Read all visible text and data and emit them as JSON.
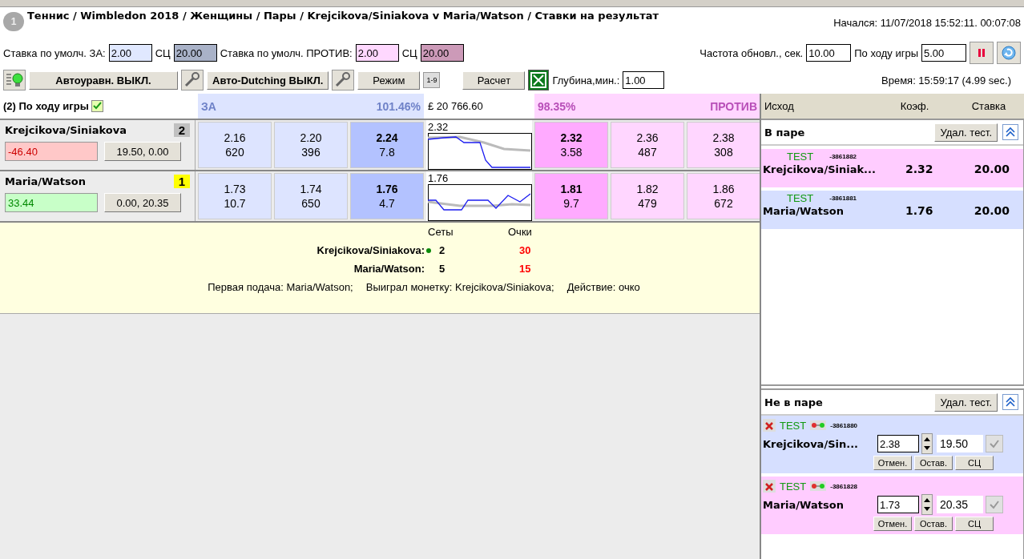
{
  "header": {
    "icon_label": "1",
    "title": "Теннис / Wimbledon 2018 / Женщины / Пары / Krejcikova/Siniakova v Maria/Watson / Ставки на результат",
    "started": "Начался: 11/07/2018 15:52:11. 00:07:08"
  },
  "stakes": {
    "back_label": "Ставка по умолч. ЗА:",
    "back_value": "2.00",
    "back_sc_label": "СЦ",
    "back_sc_value": "20.00",
    "lay_label": "Ставка по умолч. ПРОТИВ:",
    "lay_value": "2.00",
    "lay_sc_label": "СЦ",
    "lay_sc_value": "20.00",
    "refresh_label": "Частота обновл., сек.",
    "refresh_value": "10.00",
    "inplay_label": "По ходу игры",
    "inplay_value": "5.00"
  },
  "toolbar": {
    "autobalance": "Автоуравн. ВЫКЛ.",
    "dutching": "Авто-Dutching ВЫКЛ.",
    "mode": "Режим",
    "ladder_icon_label": "1-9",
    "calc": "Расчет",
    "depth_label": "Глубина,мин.:",
    "depth_value": "1.00",
    "time": "Время: 15:59:17 (4.99 sec.)"
  },
  "market": {
    "title": "(2) По ходу игры",
    "checked": true,
    "back_header": "ЗА",
    "back_percent": "101.46%",
    "matched": "£ 20 766.60",
    "lay_percent": "98.35%",
    "lay_header": "ПРОТИВ"
  },
  "runners": [
    {
      "name": "Krejcikova/Siniakova",
      "badge": "2",
      "color": "#c0c0c0",
      "pnl": "-46.40",
      "pnl_negative": true,
      "stakes": "19.50, 0.00",
      "back": [
        {
          "price": "2.16",
          "size": "620"
        },
        {
          "price": "2.20",
          "size": "396"
        },
        {
          "price": "2.24",
          "size": "7.8"
        }
      ],
      "last": "2.32",
      "lay": [
        {
          "price": "2.32",
          "size": "3.58"
        },
        {
          "price": "2.36",
          "size": "487"
        },
        {
          "price": "2.38",
          "size": "308"
        }
      ]
    },
    {
      "name": "Maria/Watson",
      "badge": "1",
      "color": "#ffff00",
      "pnl": "33.44",
      "pnl_negative": false,
      "stakes": "0.00, 20.35",
      "back": [
        {
          "price": "1.73",
          "size": "10.7"
        },
        {
          "price": "1.74",
          "size": "650"
        },
        {
          "price": "1.76",
          "size": "4.7"
        }
      ],
      "last": "1.76",
      "lay": [
        {
          "price": "1.81",
          "size": "9.7"
        },
        {
          "price": "1.82",
          "size": "479"
        },
        {
          "price": "1.86",
          "size": "672"
        }
      ]
    }
  ],
  "score": {
    "sets_header": "Сеты",
    "points_header": "Очки",
    "teams": [
      {
        "name": "Krejcikova/Siniakova:",
        "serving": true,
        "sets": "2",
        "points": "30"
      },
      {
        "name": "Maria/Watson:",
        "serving": false,
        "sets": "5",
        "points": "15"
      }
    ],
    "facts": [
      "Первая подача: Maria/Watson;",
      "Выиграл монетку: Krejcikova/Siniakova;",
      "Действие: очко"
    ]
  },
  "bets_columns": [
    "Исход",
    "Коэф.",
    "Ставка"
  ],
  "matched": {
    "title": "В паре",
    "button": "Удал. тест.",
    "bets": [
      {
        "tag": "TEST",
        "id": "-3861882",
        "name": "Krejcikova/Siniak...",
        "odds": "2.32",
        "stake": "20.00",
        "lay": true
      },
      {
        "tag": "TEST",
        "id": "-3861881",
        "name": "Maria/Watson",
        "odds": "1.76",
        "stake": "20.00",
        "lay": false
      }
    ]
  },
  "unmatched": {
    "title": "Не в паре",
    "button": "Удал. тест.",
    "bets": [
      {
        "tag": "TEST",
        "id": "-3861880",
        "name": "Krejcikova/Sin...",
        "odds": "2.38",
        "stake": "19.50",
        "lay": false,
        "buttons": [
          "Отмен.",
          "Остав.",
          "СЦ"
        ]
      },
      {
        "tag": "TEST",
        "id": "-3861828",
        "name": "Maria/Watson",
        "odds": "1.73",
        "stake": "20.35",
        "lay": true,
        "buttons": [
          "Отмен.",
          "Остав.",
          "СЦ"
        ]
      }
    ]
  }
}
